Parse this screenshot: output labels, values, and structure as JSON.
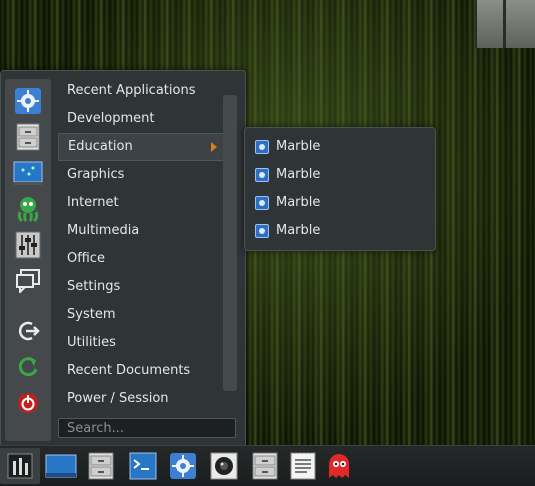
{
  "main_menu": {
    "categories": [
      {
        "label": "Recent Applications"
      },
      {
        "label": "Development"
      },
      {
        "label": "Education",
        "active": true
      },
      {
        "label": "Graphics"
      },
      {
        "label": "Internet"
      },
      {
        "label": "Multimedia"
      },
      {
        "label": "Office"
      },
      {
        "label": "Settings"
      },
      {
        "label": "System"
      },
      {
        "label": "Utilities"
      },
      {
        "label": "Recent Documents"
      },
      {
        "label": "Power / Session"
      }
    ],
    "search_placeholder": "Search...",
    "favorites": [
      "settings-gear-icon",
      "file-cabinet-icon",
      "desktop-display-icon",
      "octopus-icon",
      "mixer-icon",
      "chat-bubble-icon",
      "logout-icon",
      "restart-icon",
      "shutdown-icon"
    ]
  },
  "submenu": {
    "items": [
      {
        "label": "Marble",
        "icon": "marble-globe-icon"
      },
      {
        "label": "Marble",
        "icon": "marble-globe-icon"
      },
      {
        "label": "Marble",
        "icon": "marble-globe-icon"
      },
      {
        "label": "Marble",
        "icon": "marble-globe-icon"
      }
    ]
  },
  "taskbar": {
    "items": [
      "start-menu-icon",
      "desktop-icon",
      "file-cabinet-icon",
      "terminal-icon",
      "settings-gear-icon",
      "camera-icon",
      "file-cabinet-icon",
      "text-editor-icon",
      "ghost-icon"
    ]
  },
  "colors": {
    "accent": "#e07a1a",
    "menu_bg": "#2f3436",
    "marble_blue": "#2c6fc4"
  }
}
